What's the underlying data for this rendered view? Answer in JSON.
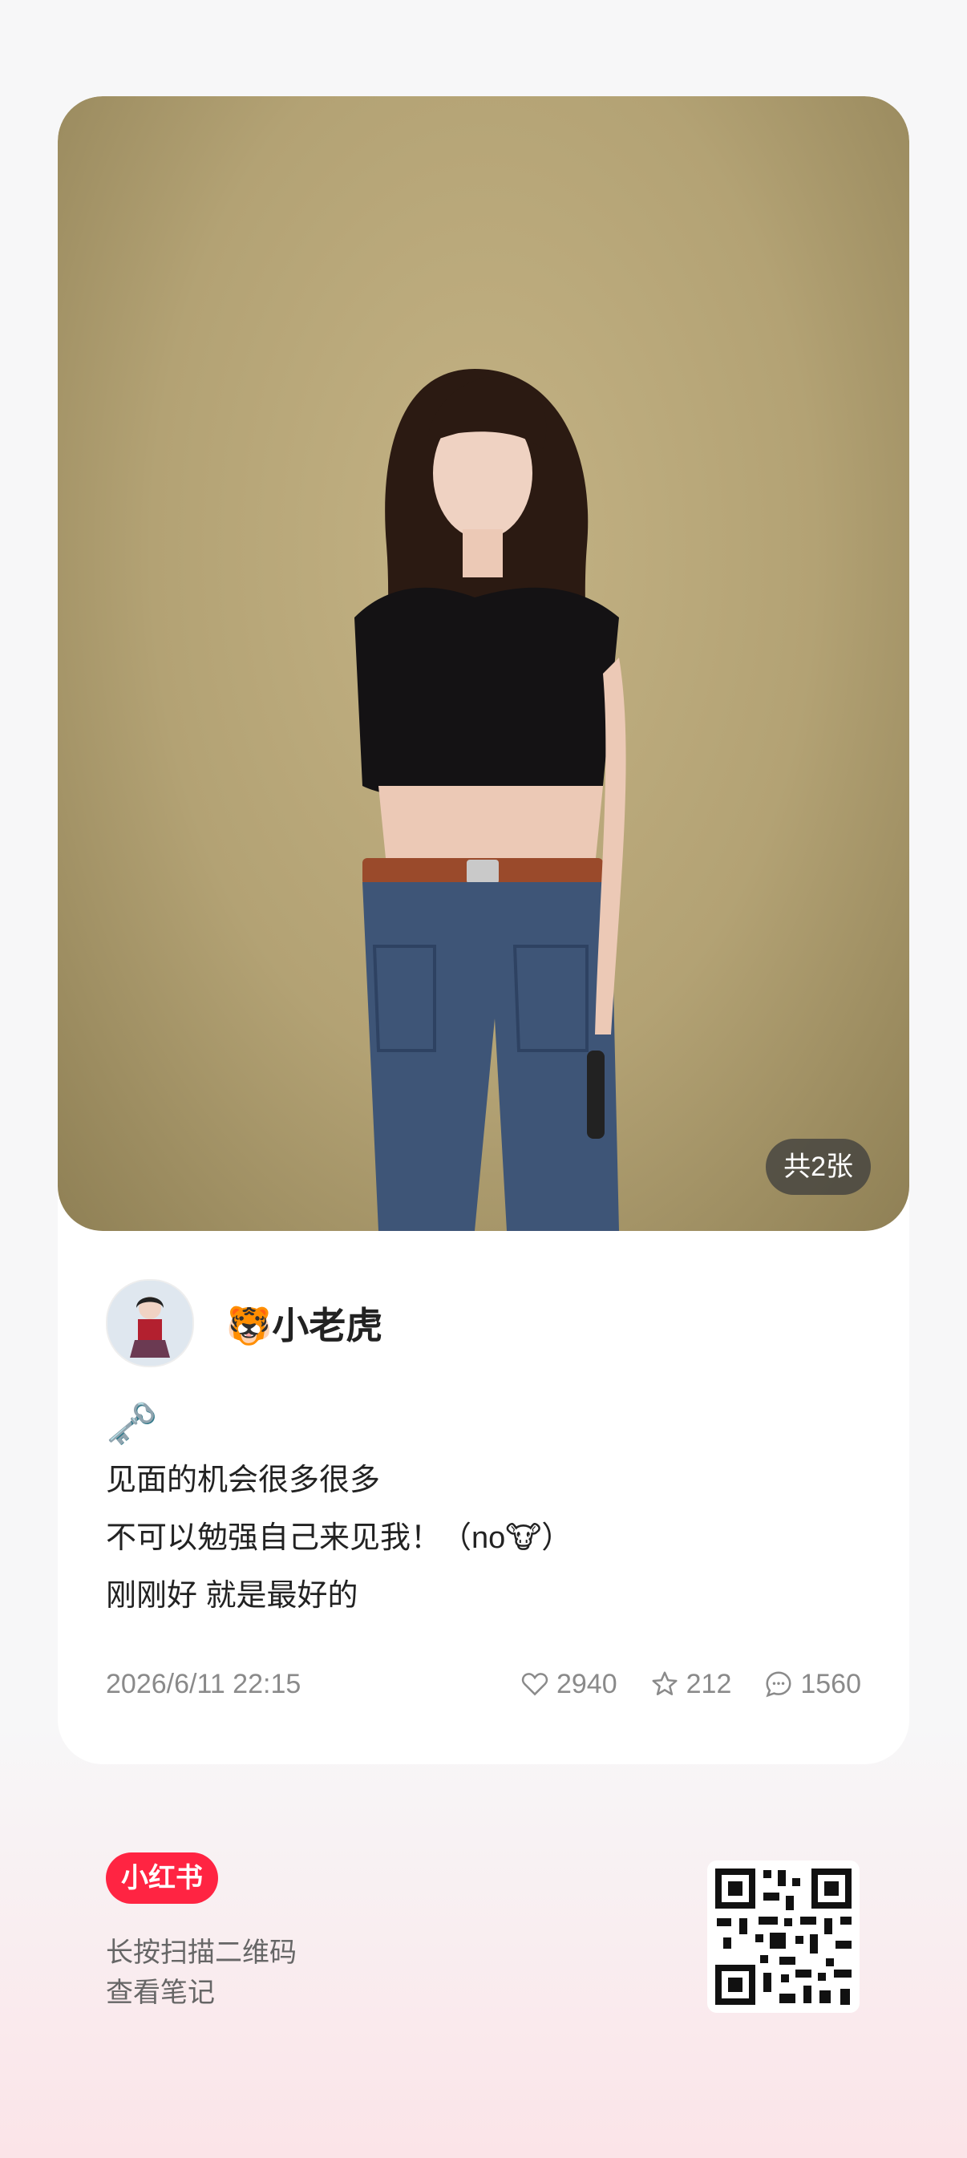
{
  "post": {
    "image_count_label": "共2张",
    "author": {
      "emoji": "🐯",
      "name": "小老虎"
    },
    "content": {
      "lead_emoji": "🗝️",
      "lines": [
        "见面的机会很多很多",
        "不可以勉强自己来见我！（no🐮）",
        "刚刚好 就是最好的"
      ]
    },
    "meta": {
      "date": "2026/6/11 22:15",
      "likes": "2940",
      "collects": "212",
      "comments": "1560"
    }
  },
  "footer": {
    "logo_text": "小红书",
    "prompt_line1": "长按扫描二维码",
    "prompt_line2": "查看笔记"
  },
  "colors": {
    "brand": "#ff2442",
    "meta_text": "#8a8a8a"
  }
}
